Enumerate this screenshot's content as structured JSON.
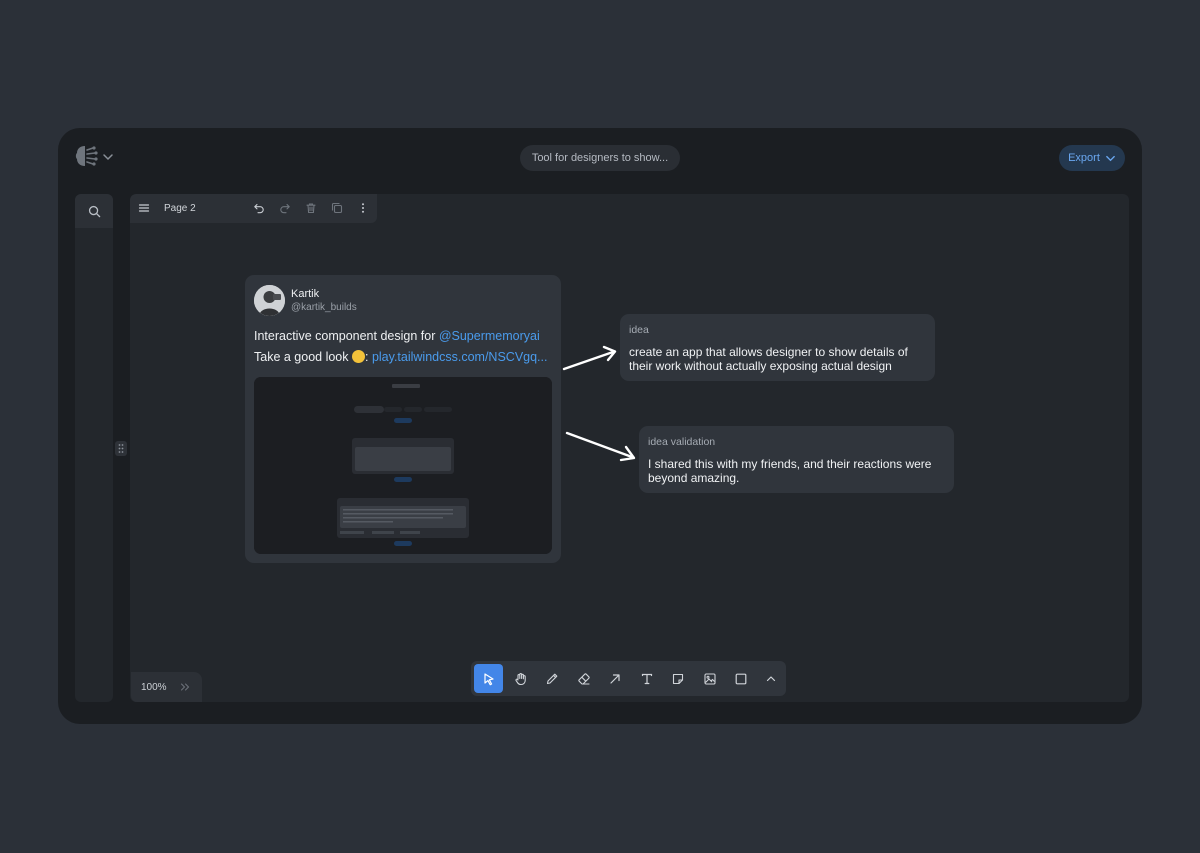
{
  "header": {
    "doc_title": "Tool for designers to show...",
    "export_label": "Export",
    "logo_icon": "brain-logo-icon"
  },
  "sidebar": {
    "search_icon": "search-icon"
  },
  "page_toolbar": {
    "page_name": "Page 2",
    "icons": [
      "menu-icon",
      "undo-icon",
      "redo-icon",
      "trash-icon",
      "duplicate-icon",
      "more-vertical-icon"
    ]
  },
  "tweet": {
    "name": "Kartik",
    "handle": "@kartik_builds",
    "line1_text": "Interactive component design for ",
    "line1_mention": "@Supermemoryai",
    "line2_text": "Take a good look ",
    "line2_colon": ": ",
    "line2_link": "play.tailwindcss.com/NSCVgq..."
  },
  "notes": [
    {
      "label": "idea",
      "body": "create an app that allows designer to show details of their work without actually exposing actual design"
    },
    {
      "label": "idea validation",
      "body": "I shared this with my friends, and their reactions were beyond amazing."
    }
  ],
  "zoom": {
    "value": "100%"
  },
  "tools": [
    "select-pointer-icon",
    "hand-icon",
    "pencil-icon",
    "eraser-icon",
    "arrow-icon",
    "text-icon",
    "sticky-note-icon",
    "image-icon",
    "rectangle-icon",
    "chevron-up-icon"
  ],
  "colors": {
    "accent": "#4386e8",
    "link": "#4a9bec",
    "export_text": "#6aa7f0",
    "background": "#2b3038",
    "window": "#1b1e22"
  }
}
